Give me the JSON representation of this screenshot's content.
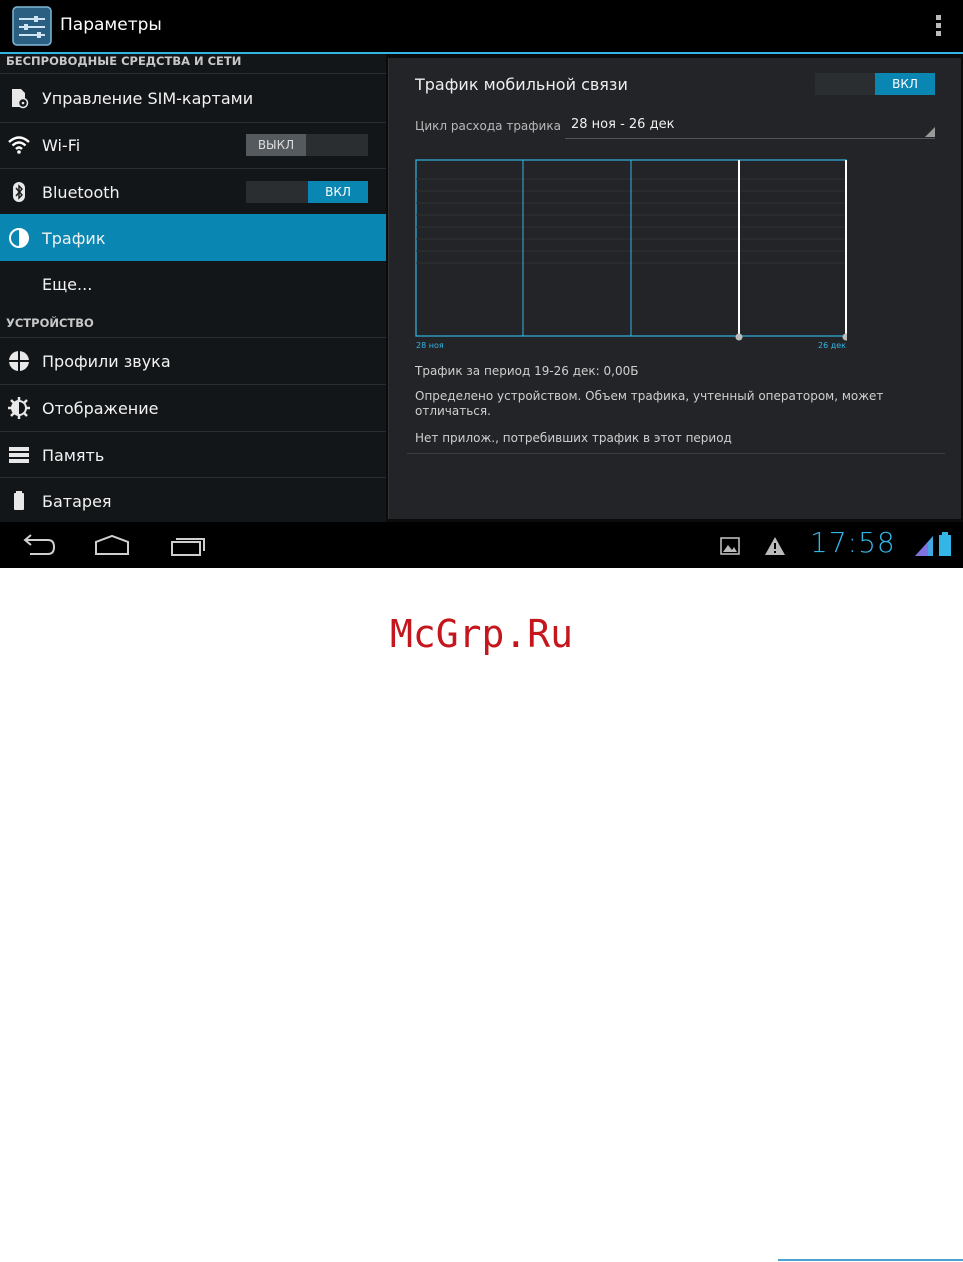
{
  "action_bar": {
    "title": "Параметры"
  },
  "sections": {
    "wireless": "БЕСПРОВОДНЫЕ СРЕДСТВА И СЕТИ",
    "device": "УСТРОЙСТВО"
  },
  "left_items": [
    {
      "label": "Управление SIM-картами",
      "icon": "sim-settings-icon"
    },
    {
      "label": "Wi-Fi",
      "icon": "wifi-icon",
      "toggle": "ВЫКЛ"
    },
    {
      "label": "Bluetooth",
      "icon": "bluetooth-icon",
      "toggle": "ВКЛ"
    },
    {
      "label": "Трафик",
      "icon": "data-usage-icon",
      "active": true
    },
    {
      "label": "Еще..."
    },
    {
      "label": "Профили звука",
      "icon": "sound-icon"
    },
    {
      "label": "Отображение",
      "icon": "display-icon"
    },
    {
      "label": "Память",
      "icon": "storage-icon"
    },
    {
      "label": "Батарея",
      "icon": "battery-icon"
    }
  ],
  "panel": {
    "title": "Трафик мобильной связи",
    "mobile_toggle": "ВКЛ",
    "cycle_label": "Цикл расхода трафика",
    "cycle_value": "28 ноя - 26 дек",
    "chart_start_label": "28 ноя",
    "chart_end_label": "26 дек",
    "period_usage": "Трафик за период 19-26 дек: 0,00Б",
    "device_note": "Определено устройством. Объем трафика, учтенный оператором, может отличаться.",
    "no_apps": "Нет прилож., потребивших трафик в этот период"
  },
  "status_bar": {
    "time": "17:58"
  },
  "accent_color": "#33b5e5",
  "watermark": "McGrp.Ru"
}
